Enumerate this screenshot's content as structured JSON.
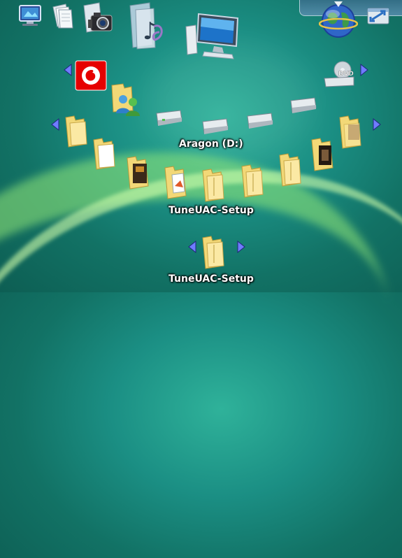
{
  "labels": {
    "drive_label": "Aragon (D:)",
    "folder_label": "TuneUAC-Setup",
    "bottom_label": "TuneUAC-Setup",
    "dvd_text": "DVD"
  },
  "colors": {
    "folder": "#f2d877",
    "folder_dark": "#d8b44a",
    "arrow": "#6f7cff",
    "vodafone": "#e60000"
  },
  "icons": [
    "display-settings-icon",
    "documents-icon",
    "camera-icon",
    "music-icon",
    "computer-icon",
    "globe-icon",
    "window-switch-icon",
    "vodafone-icon",
    "contacts-icon",
    "dvd-drive-icon",
    "hard-drive-icon",
    "folder-icon"
  ]
}
